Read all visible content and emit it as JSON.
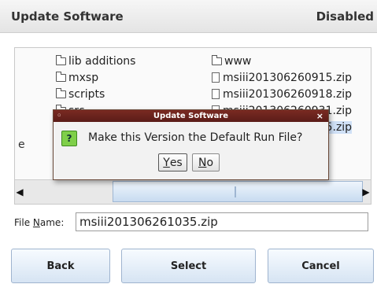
{
  "header": {
    "title": "Update Software",
    "status": "Disabled"
  },
  "file_browser": {
    "row_label_partial": "e",
    "columns": [
      [
        {
          "name": "lib additions",
          "icon": "folder-icon"
        },
        {
          "name": "mxsp",
          "icon": "folder-icon"
        },
        {
          "name": "scripts",
          "icon": "folder-icon"
        },
        {
          "name": "src",
          "icon": "folder-icon"
        }
      ],
      [
        {
          "name": "www",
          "icon": "folder-icon"
        },
        {
          "name": "msiii201306260915.zip",
          "icon": "file-icon"
        },
        {
          "name": "msiii201306260918.zip",
          "icon": "file-icon"
        },
        {
          "name": "msiii201306260931.zip",
          "icon": "file-icon"
        },
        {
          "name": "msiii201306261035.zip",
          "icon": "file-icon",
          "selected": true
        }
      ]
    ]
  },
  "file_name": {
    "label_prefix": "File ",
    "label_underlined": "N",
    "label_suffix": "ame:",
    "value": "msiii201306261035.zip"
  },
  "buttons": {
    "back": "Back",
    "select": "Select",
    "cancel": "Cancel"
  },
  "dialog": {
    "title": "Update Software",
    "close": "×",
    "icon_glyph": "?",
    "message": "Make this Version the Default Run File?",
    "yes_u": "Y",
    "yes_rest": "es",
    "no_u": "N",
    "no_rest": "o"
  },
  "colors": {
    "accent": "#cfe0f6",
    "dialog_title": "#6a2420",
    "question_icon": "#7fcf49"
  }
}
